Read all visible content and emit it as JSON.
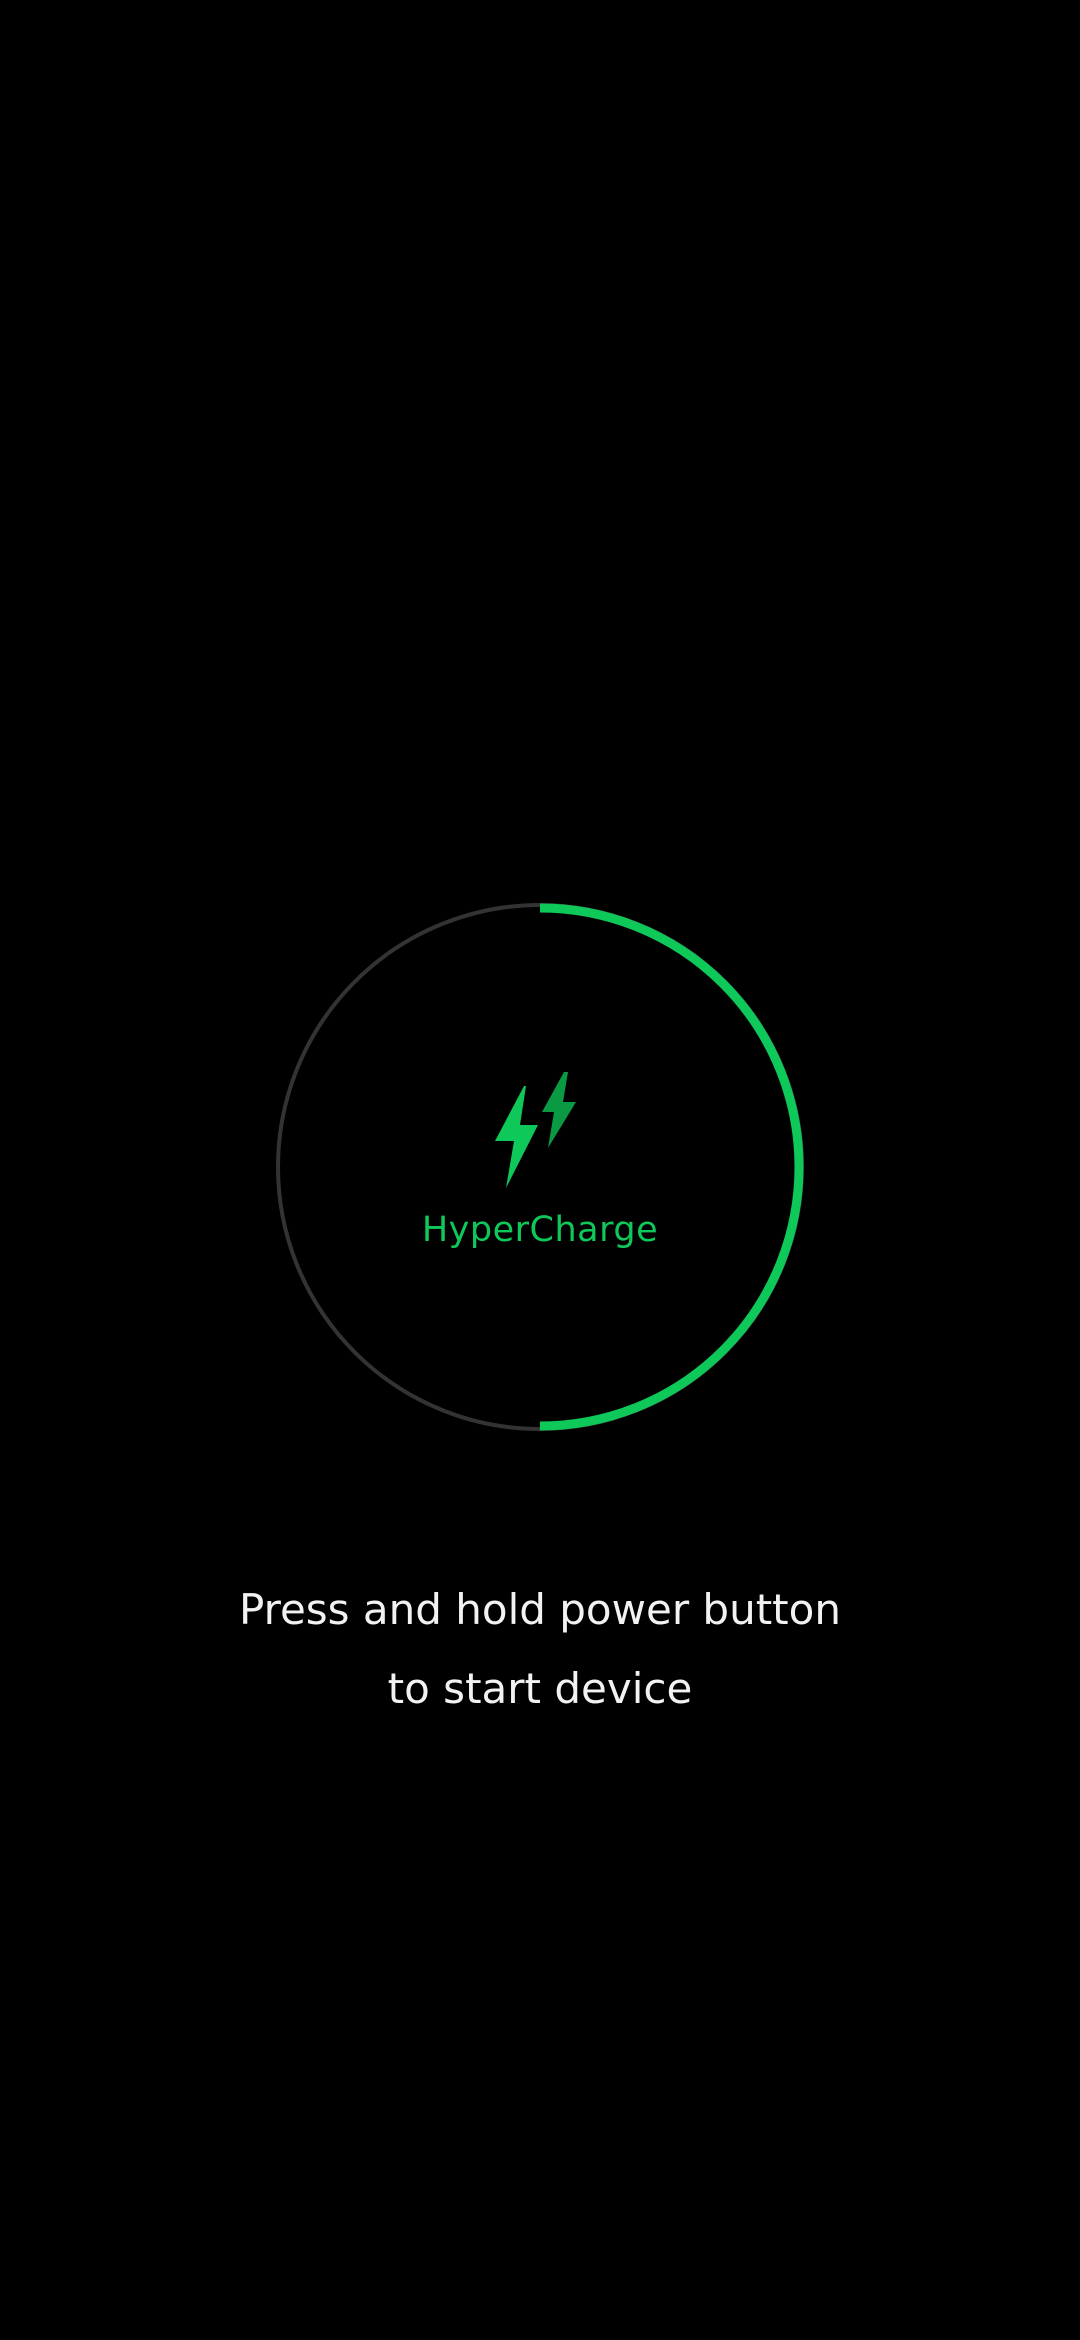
{
  "charging": {
    "mode_label": "HyperCharge",
    "progress_fraction": 0.5,
    "colors": {
      "accent": "#0fc85a",
      "accent_dark": "#0a9a44",
      "track": "#333333",
      "background": "#000000",
      "text": "#f2f2f2"
    },
    "icon": "double-lightning-bolt-icon"
  },
  "instruction": {
    "line1": "Press and hold power button",
    "line2": "to start device"
  }
}
